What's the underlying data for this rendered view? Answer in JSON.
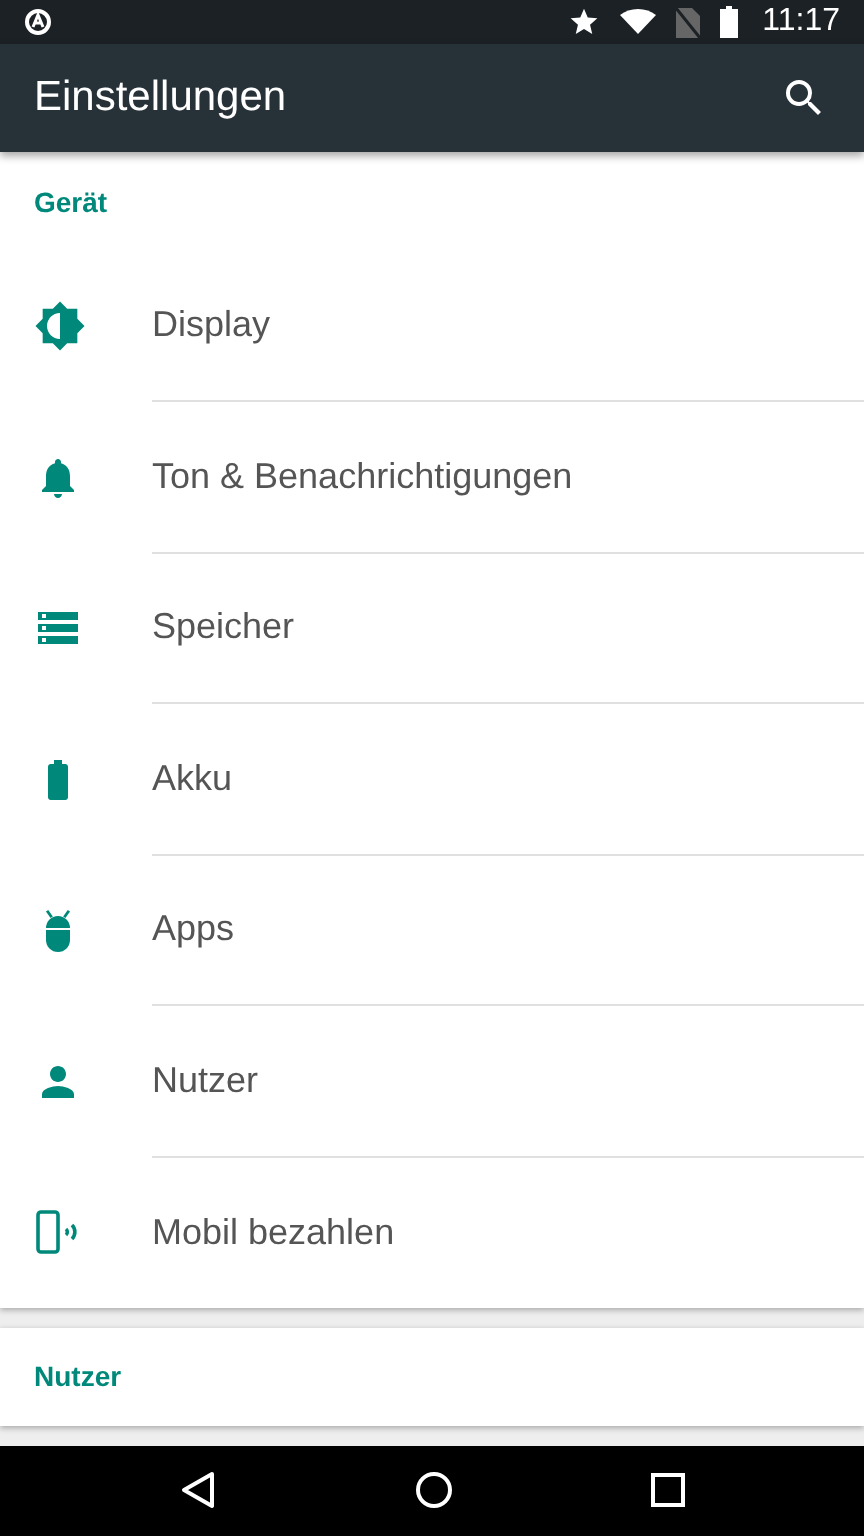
{
  "status_bar": {
    "time": "11:17"
  },
  "app_bar": {
    "title": "Einstellungen"
  },
  "sections": [
    {
      "header": "Gerät",
      "items": [
        {
          "label": "Display",
          "kind": "brightness"
        },
        {
          "label": "Ton & Benachrichtigungen",
          "kind": "bell"
        },
        {
          "label": "Speicher",
          "kind": "storage"
        },
        {
          "label": "Akku",
          "kind": "battery"
        },
        {
          "label": "Apps",
          "kind": "android"
        },
        {
          "label": "Nutzer",
          "kind": "person"
        },
        {
          "label": "Mobil bezahlen",
          "kind": "phone"
        }
      ]
    },
    {
      "header": "Nutzer"
    }
  ]
}
